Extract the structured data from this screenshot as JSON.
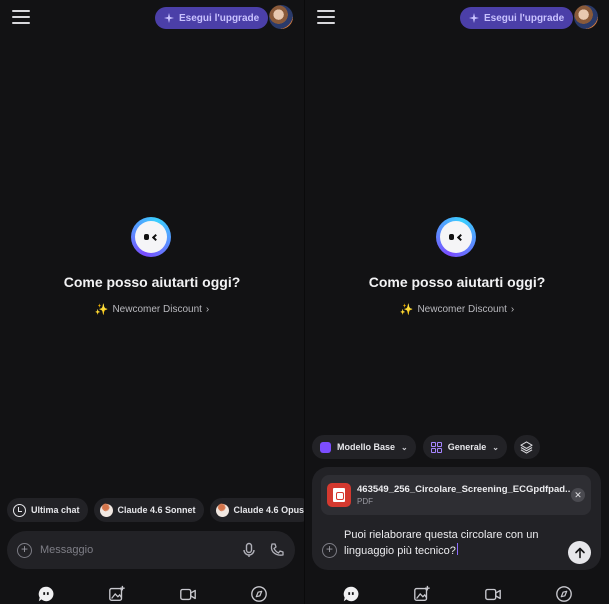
{
  "header": {
    "upgrade_label": "Esegui l'upgrade"
  },
  "welcome": {
    "headline": "Come posso aiutarti oggi?",
    "discount_label": "Newcomer Discount",
    "discount_chevron": "›"
  },
  "left": {
    "chips": [
      {
        "label": "Ultima chat",
        "icon": "clock-icon"
      },
      {
        "label": "Claude 4.6 Sonnet",
        "icon": "claude-icon"
      },
      {
        "label": "Claude 4.6 Opus",
        "icon": "claude-icon"
      }
    ],
    "message_placeholder": "Messaggio"
  },
  "right": {
    "model_label": "Modello Base",
    "category_label": "Generale",
    "attachment": {
      "file_name": "463549_256_Circolare_Screening_ECGpdfpad...",
      "file_type": "PDF"
    },
    "typed_text": "Puoi rielaborare questa circolare con un linguaggio più tecnico?"
  },
  "nav": [
    "chat-icon",
    "image-create-icon",
    "video-icon",
    "compass-icon"
  ],
  "colors": {
    "accent": "#4b3fa8",
    "accent_text": "#c9c2ff",
    "background": "#121214",
    "surface": "#222226"
  }
}
